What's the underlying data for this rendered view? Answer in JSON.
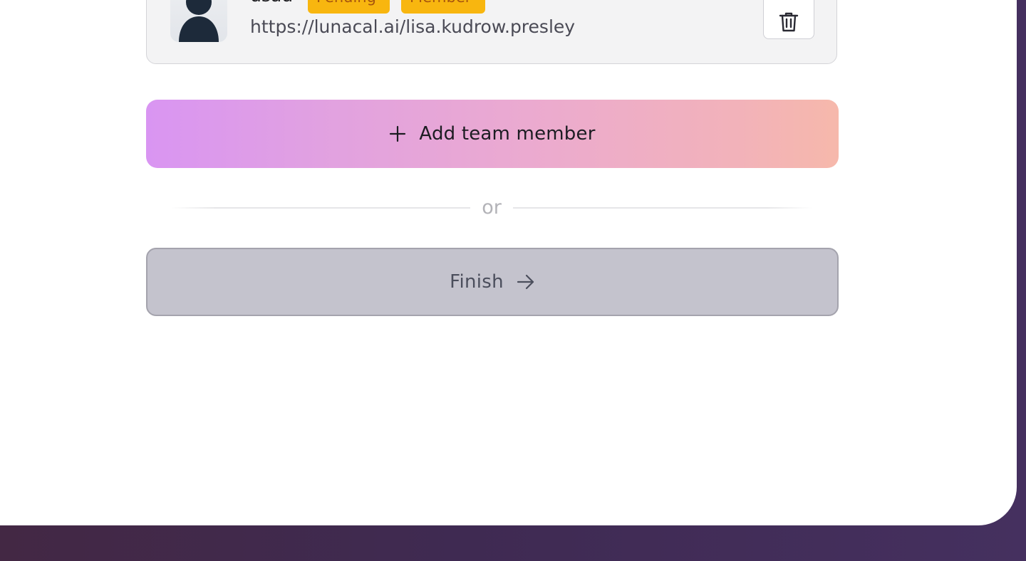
{
  "member": {
    "name": "dsad",
    "status_badge": "Pending",
    "role_badge": "Member",
    "url": "https://lunacal.ai/lisa.kudrow.presley",
    "avatar_icon": "user-silhouette-icon",
    "delete_icon": "trash-icon"
  },
  "add_member": {
    "label": "Add team member",
    "icon": "plus-icon"
  },
  "divider": {
    "text": "or"
  },
  "finish": {
    "label": "Finish",
    "icon": "arrow-right-icon"
  },
  "colors": {
    "badge_background": "#f8b60f",
    "badge_text": "#a8560d",
    "gradient_start": "#d995f2",
    "gradient_end": "#f6b8ab",
    "finish_background": "#c4c3cd",
    "outer_background": "#432844"
  }
}
